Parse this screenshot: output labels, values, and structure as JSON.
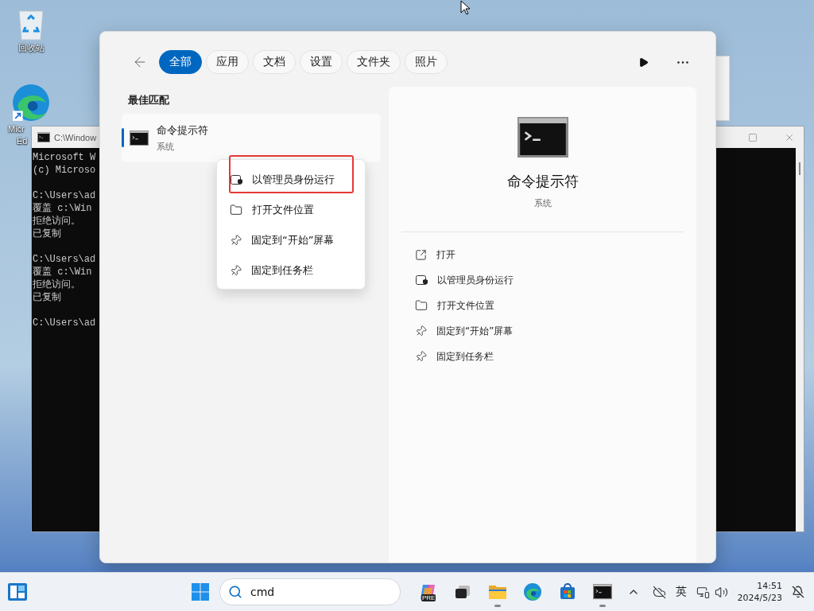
{
  "desktop_icons": [
    {
      "kind": "recycle",
      "label_lines": [
        "回收站"
      ]
    },
    {
      "kind": "edge",
      "label_lines": [
        "Micr",
        "Ed"
      ]
    }
  ],
  "console_window": {
    "title": "C:\\Window",
    "blocks": [
      [
        "Microsoft W",
        "(c) Microso"
      ],
      [
        "C:\\Users\\ad",
        "覆盖 c:\\Win",
        "拒绝访问。",
        "已复制"
      ],
      [
        "C:\\Users\\ad",
        "覆盖 c:\\Win",
        "拒绝访问。",
        "已复制"
      ],
      [
        "C:\\Users\\ad"
      ]
    ]
  },
  "search_panel": {
    "tabs": [
      {
        "label": "全部",
        "selected": true
      },
      {
        "label": "应用",
        "selected": false
      },
      {
        "label": "文档",
        "selected": false
      },
      {
        "label": "设置",
        "selected": false
      },
      {
        "label": "文件夹",
        "selected": false
      },
      {
        "label": "照片",
        "selected": false
      }
    ],
    "section_title": "最佳匹配",
    "result": {
      "title": "命令提示符",
      "subtitle": "系统",
      "selected": true
    },
    "context_menu": [
      {
        "kind": "admin",
        "label": "以管理员身份运行",
        "highlighted": true
      },
      {
        "kind": "folder",
        "label": "打开文件位置",
        "highlighted": false
      },
      {
        "kind": "pin",
        "label": "固定到“开始”屏幕",
        "highlighted": false
      },
      {
        "kind": "pin",
        "label": "固定到任务栏",
        "highlighted": false
      }
    ],
    "details": {
      "title": "命令提示符",
      "subtitle": "系统",
      "actions": [
        {
          "kind": "open",
          "label": "打开"
        },
        {
          "kind": "admin",
          "label": "以管理员身份运行"
        },
        {
          "kind": "folder",
          "label": "打开文件位置"
        },
        {
          "kind": "pin",
          "label": "固定到“开始”屏幕"
        },
        {
          "kind": "pin",
          "label": "固定到任务栏"
        }
      ]
    }
  },
  "taskbar": {
    "search_value": "cmd",
    "apps": [
      {
        "kind": "copilot",
        "badge": "PRE",
        "running": false
      },
      {
        "kind": "taskview",
        "running": false
      },
      {
        "kind": "explorer",
        "running": true
      },
      {
        "kind": "edge",
        "running": false
      },
      {
        "kind": "store",
        "running": false
      },
      {
        "kind": "terminal",
        "running": true
      }
    ],
    "ime": "英",
    "time": "14:51",
    "date": "2024/5/23"
  }
}
